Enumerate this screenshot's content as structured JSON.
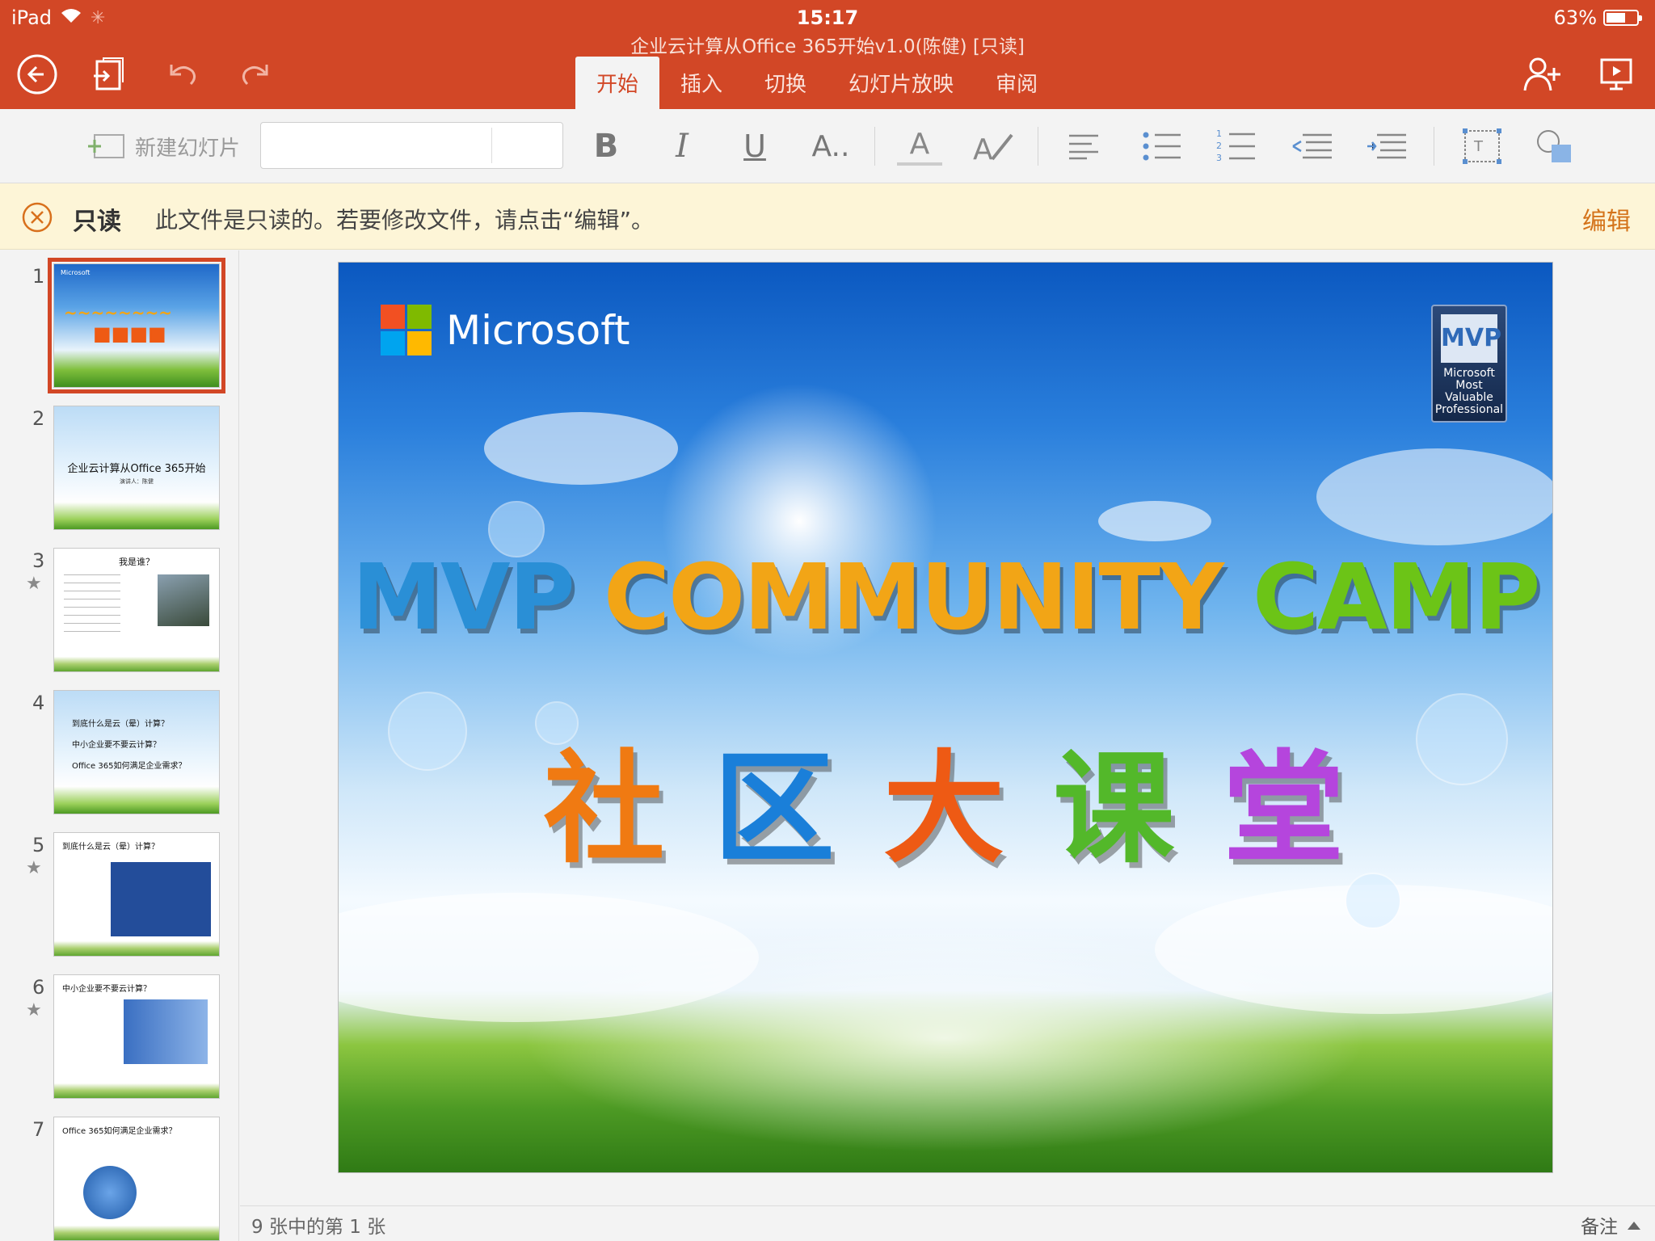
{
  "status": {
    "device": "iPad",
    "time": "15:17",
    "battery": "63%",
    "battery_level": 0.63
  },
  "document_title": "企业云计算从Office 365开始v1.0(陈健) [只读]",
  "tabs": [
    "开始",
    "插入",
    "切换",
    "幻灯片放映",
    "审阅"
  ],
  "ribbon": {
    "new_slide": "新建幻灯片",
    "bold": "B",
    "italic": "I",
    "underline": "U",
    "more_font": "A..",
    "font_color": "A"
  },
  "readonly_bar": {
    "label": "只读",
    "message": "此文件是只读的。若要修改文件，请点击“编辑”。",
    "edit": "编辑"
  },
  "thumbnails": [
    {
      "num": "1",
      "title": "",
      "has_star": false
    },
    {
      "num": "2",
      "title": "企业云计算从Office 365开始",
      "subtitle": "演讲人：陈健",
      "has_star": false
    },
    {
      "num": "3",
      "title": "我是谁？",
      "has_star": true
    },
    {
      "num": "4",
      "lines": [
        "到底什么是云（晕）计算？",
        "中小企业要不要云计算？",
        "Office 365如何满足企业需求？"
      ],
      "has_star": false
    },
    {
      "num": "5",
      "title": "到底什么是云（晕）计算？",
      "has_star": true
    },
    {
      "num": "6",
      "title": "中小企业要不要云计算？",
      "has_star": true
    },
    {
      "num": "7",
      "title": "Office 365如何满足企业需求？",
      "has_star": false
    }
  ],
  "slide": {
    "brand": "Microsoft",
    "mvp_badge": {
      "big": "MVP",
      "l1": "Microsoft",
      "l2": "Most Valuable",
      "l3": "Professional"
    },
    "headline": [
      {
        "text": "MVP",
        "color": "#2a8fd6"
      },
      {
        "text": "COMMUNITY",
        "color": "#f2a516"
      },
      {
        "text": "CAMP",
        "color": "#6cc417"
      }
    ],
    "chinese": [
      {
        "text": "社",
        "color": "#f07a12"
      },
      {
        "text": "区",
        "color": "#1a7fd9"
      },
      {
        "text": "大",
        "color": "#ee5a14"
      },
      {
        "text": "课",
        "color": "#53b82a"
      },
      {
        "text": "堂",
        "color": "#b545dd"
      }
    ]
  },
  "footer": {
    "page_info": "9 张中的第 1 张",
    "notes": "备注"
  }
}
